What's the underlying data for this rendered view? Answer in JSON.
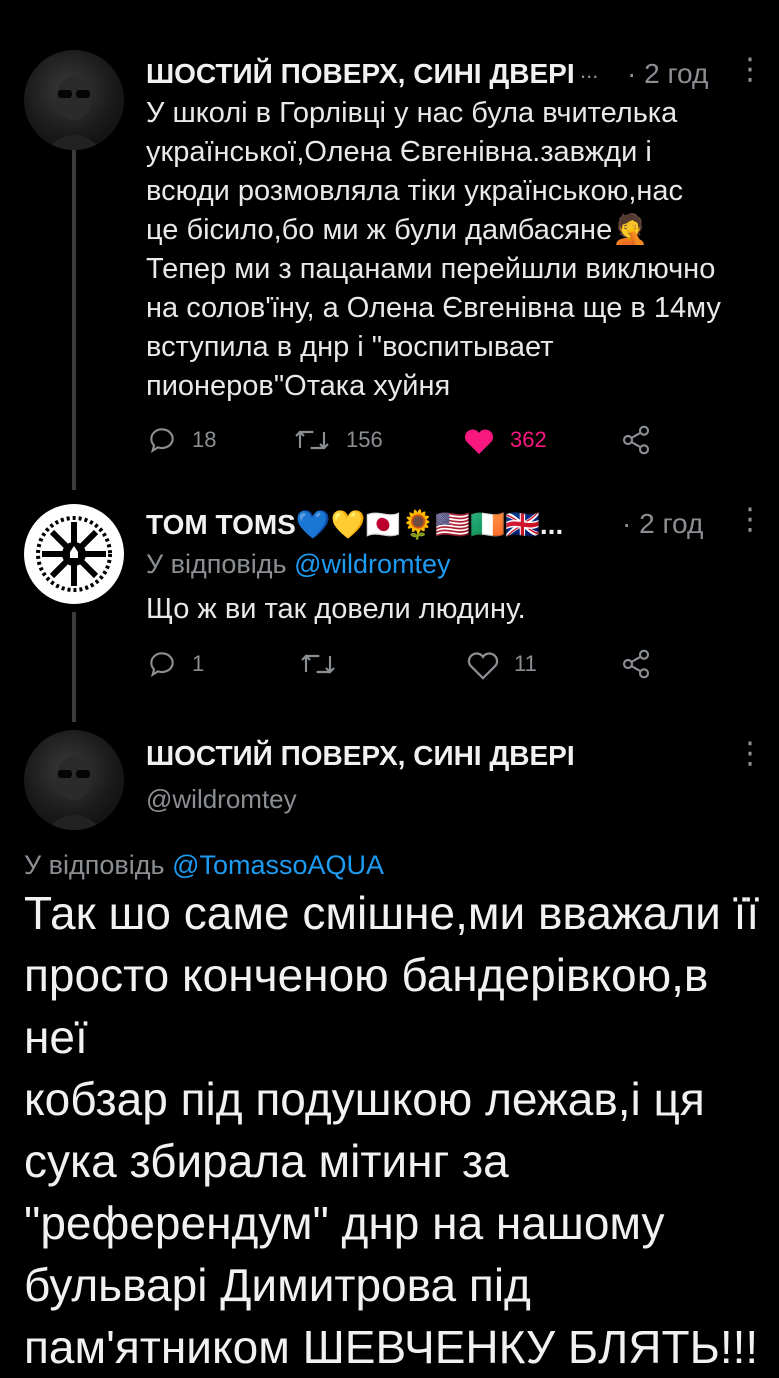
{
  "tweet1": {
    "name": "ШОСТИЙ ПОВЕРХ, СИНІ ДВЕРІ",
    "ellipsis": "...",
    "time": "· 2 год",
    "lines": [
      "У школі в Горлівці у нас була вчителька",
      "української,Олена Євгенівна.завжди і",
      "всюди розмовляла тіки українською,нас",
      "це бісило,бо ми ж були дамбасяне🤦",
      "Тепер ми з пацанами перейшли виключно",
      "на солов'їну, а Олена Євгенівна ще в 14му",
      "вступила в днр і \"воспитывает",
      "пионеров\"Отака хуйня"
    ],
    "replies": "18",
    "retweets": "156",
    "likes": "362"
  },
  "tweet2": {
    "name": "TOM TOMS💙💛🇯🇵🌻🇺🇸🇮🇪🇬🇧...",
    "time": "· 2 год",
    "reply_prefix": "У відповідь ",
    "reply_to": "@wildromtey",
    "text": "Що ж ви так довели людину.",
    "replies": "1",
    "retweets": "",
    "likes": "11"
  },
  "tweet3": {
    "name": "ШОСТИЙ ПОВЕРХ, СИНІ ДВЕРІ",
    "handle": "@wildromtey",
    "reply_prefix": "У відповідь ",
    "reply_to": "@TomassoAQUA",
    "lines": [
      "Так шо саме смішне,ми вважали її",
      "просто конченою бандерівкою,в неї",
      "кобзар під подушкою лежав,і ця",
      "сука збирала мітинг за",
      "\"референдум\" днр на нашому",
      "бульварі Димитрова  під",
      "пам'ятником ШЕВЧЕНКУ БЛЯТЬ!!!"
    ]
  },
  "colors": {
    "accent": "#1d9bf0",
    "like": "#f91880",
    "muted": "#8b8f93"
  },
  "icons": [
    "reply-icon",
    "retweet-icon",
    "like-icon",
    "share-icon",
    "more-icon"
  ]
}
